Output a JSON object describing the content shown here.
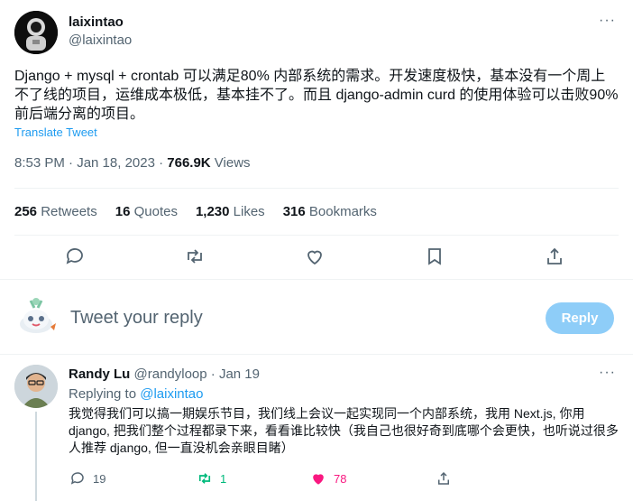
{
  "tweet": {
    "author_name": "laixintao",
    "author_handle": "@laixintao",
    "more": "···",
    "text": "Django + mysql + crontab 可以满足80% 内部系统的需求。开发速度极快，基本没有一个周上不了线的项目，运维成本极低，基本挂不了。而且 django-admin curd 的使用体验可以击败90% 前后端分离的项目。",
    "translate_label": "Translate Tweet",
    "timestamp": "8:53 PM · Jan 18, 2023 · ",
    "views_count": "766.9K",
    "views_label": " Views",
    "stats": {
      "retweets_count": "256",
      "retweets_label": " Retweets",
      "quotes_count": "16",
      "quotes_label": " Quotes",
      "likes_count": "1,230",
      "likes_label": " Likes",
      "bookmarks_count": "316",
      "bookmarks_label": " Bookmarks"
    }
  },
  "reply_box": {
    "placeholder": "Tweet your reply",
    "button_label": "Reply"
  },
  "reply": {
    "author_name": "Randy Lu",
    "author_handle": " @randyloop · Jan 19",
    "more": "···",
    "replying_prefix": "Replying to ",
    "replying_handle": "@laixintao",
    "text": "我觉得我们可以搞一期娱乐节目，我们线上会议一起实现同一个内部系统，我用 Next.js, 你用 django, 把我们整个过程都录下来，看看谁比较快（我自己也很好奇到底哪个会更快，也听说过很多人推荐 django, 但一直没机会亲眼目睹）",
    "replies_count": "19",
    "retweets_count": "1",
    "likes_count": "78"
  },
  "colors": {
    "accent": "#1d9bf0",
    "retweet_green": "#00ba7c",
    "like_pink": "#f91880",
    "muted": "#536471"
  },
  "icons": [
    "comment-icon",
    "retweet-icon",
    "heart-icon",
    "bookmark-icon",
    "share-icon"
  ]
}
